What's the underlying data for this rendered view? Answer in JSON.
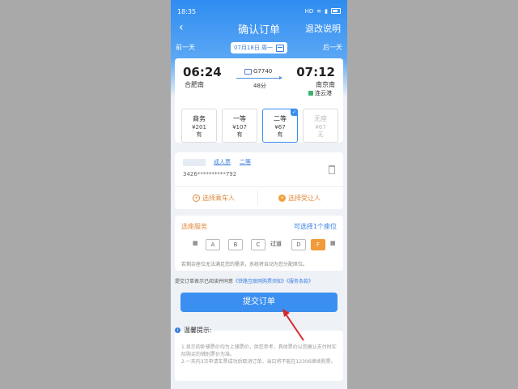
{
  "status": {
    "time": "18:35",
    "icons": [
      "volte-icon",
      "wifi-icon",
      "signal-icon",
      "battery-icon"
    ]
  },
  "nav": {
    "title": "确认订单",
    "refund": "退改说明"
  },
  "daybar": {
    "prev": "前一天",
    "date": "07月18日 周一",
    "next": "后一天"
  },
  "train": {
    "dep_time": "06:24",
    "dep_station": "合肥南",
    "number": "G7740",
    "duration": "48分",
    "arr_time": "07:12",
    "arr_station": "南京南",
    "arr_sub": "连云港"
  },
  "seats": [
    {
      "name": "商务",
      "price": "¥201",
      "avail": "有"
    },
    {
      "name": "一等",
      "price": "¥107",
      "avail": "有"
    },
    {
      "name": "二等",
      "price": "¥67",
      "avail": "有"
    },
    {
      "name": "无座",
      "price": "¥67",
      "avail": "无"
    }
  ],
  "passenger": {
    "type": "成人票",
    "seat": "二等",
    "id": "3426**********792",
    "select_passenger": "选择乘车人",
    "select_receiver": "选择受让人"
  },
  "choose_seat": {
    "title": "选座服务",
    "hint": "可选择1个座位",
    "aisle": "过道",
    "letters": [
      "A",
      "B",
      "C",
      "D",
      "F"
    ],
    "note": "若剩余座位无法满足您的需求，系统将自动为您分配席位。"
  },
  "agreement": {
    "prefix": "提交订单表示已阅读并同意",
    "link1": "《铁路互联网购票须知》",
    "link2": "《服务条款》"
  },
  "submit": "提交订单",
  "tips": {
    "title": "温馨提示:",
    "line1": "1.显示的卧铺票价均为上铺票价，供您参考，具体票价以您确认支付时实际购买的铺别票价为准。",
    "line2": "2.一天内3次申请车票成功后取消订单，当日将不能在12306继续购票。"
  },
  "colors": {
    "primary": "#3b8ff0",
    "accent": "#e0893a",
    "arrow": "#d6262b"
  }
}
